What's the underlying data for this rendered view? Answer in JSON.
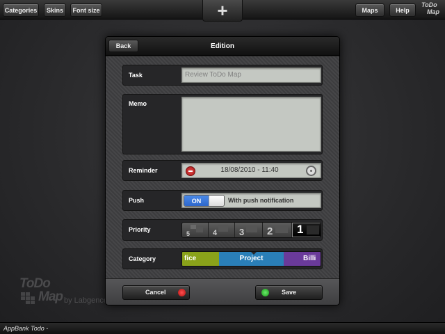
{
  "toolbar": {
    "categories_label": "Categories",
    "skins_label": "Skins",
    "font_size_label": "Font size",
    "add_symbol": "+",
    "maps_label": "Maps",
    "help_label": "Help",
    "logo_line1": "ToDo",
    "logo_line2": "Map"
  },
  "dialog": {
    "back_label": "Back",
    "title": "Edition",
    "task": {
      "label": "Task",
      "value": "Review ToDo Map"
    },
    "memo": {
      "label": "Memo",
      "value": ""
    },
    "reminder": {
      "label": "Reminder",
      "value": "18/08/2010 - 11:40"
    },
    "push": {
      "label": "Push",
      "toggle_state": "ON",
      "text": "With push notification"
    },
    "priority": {
      "label": "Priority",
      "options": [
        "5",
        "4",
        "3",
        "2",
        "1"
      ],
      "selected": "1"
    },
    "category": {
      "label": "Category",
      "options": [
        {
          "label": "fice",
          "color": "#8aa21a"
        },
        {
          "label": "Project",
          "color": "#2a7fb8"
        },
        {
          "label": "Billi",
          "color": "#6a3a9a"
        }
      ],
      "selected": "Project"
    },
    "cancel_label": "Cancel",
    "save_label": "Save"
  },
  "watermark": {
    "line1": "ToDo",
    "line2": "Map",
    "by": "by Labgence"
  },
  "status_bar": {
    "text": "AppBank Todo -"
  },
  "colors": {
    "accent_blue": "#2a62c8",
    "cancel_dot": "#d42020",
    "save_dot": "#28b428"
  }
}
